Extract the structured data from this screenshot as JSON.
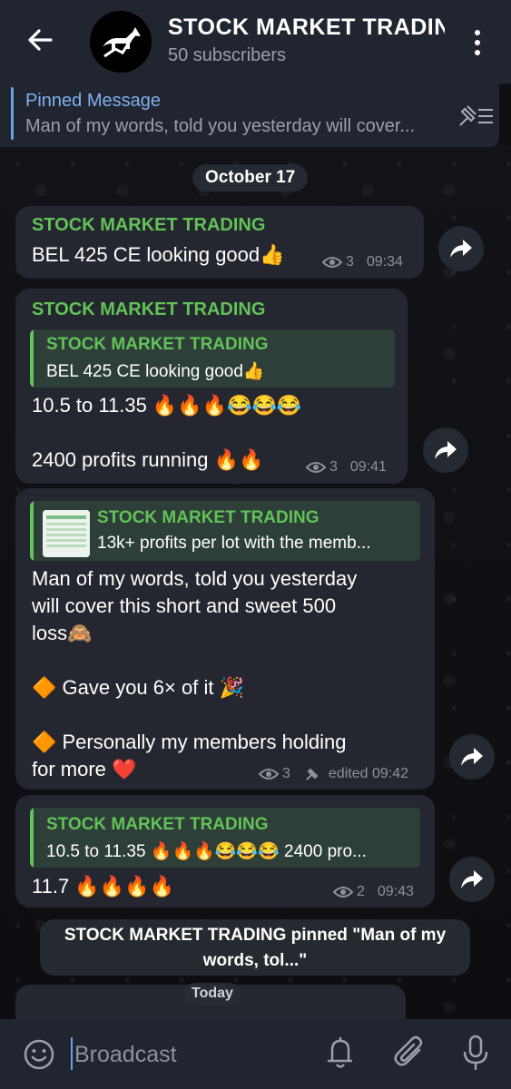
{
  "header": {
    "title": "STOCK MARKET TRADING",
    "subtitle": "50 subscribers"
  },
  "pinned": {
    "label": "Pinned Message",
    "text": "Man of my words, told you yesterday will cover..."
  },
  "date_divider": "October 17",
  "messages": [
    {
      "sender": "STOCK MARKET TRADING",
      "text": "BEL 425 CE looking good👍",
      "views": "3",
      "time": "09:34"
    },
    {
      "sender": "STOCK MARKET TRADING",
      "reply_name": "STOCK MARKET TRADING",
      "reply_text": "BEL 425 CE looking good👍",
      "text": "10.5 to 11.35 🔥🔥🔥😂😂😂\n\n2400 profits running 🔥🔥",
      "views": "3",
      "time": "09:41"
    },
    {
      "reply_name": "STOCK MARKET TRADING",
      "reply_text": "13k+ profits per lot with the memb...",
      "text": "Man of my words, told you yesterday\nwill cover this short and sweet 500\nloss🙈\n\n🔶 Gave you 6× of it 🎉\n\n🔶 Personally my members holding\nfor more ❤️",
      "views": "3",
      "time": "edited 09:42"
    },
    {
      "reply_name": "STOCK MARKET TRADING",
      "reply_text": "10.5 to 11.35 🔥🔥🔥😂😂😂  2400 pro...",
      "text": "11.7 🔥🔥🔥🔥",
      "views": "2",
      "time": "09:43"
    }
  ],
  "service_message": "STOCK MARKET TRADING pinned \"Man of my words, tol...\"",
  "today_label": "Today",
  "input": {
    "placeholder": "Broadcast"
  },
  "colors": {
    "accent": "#6aa3e6",
    "sender_green": "#62c257",
    "bubble": "#24272f",
    "header": "#212530"
  }
}
